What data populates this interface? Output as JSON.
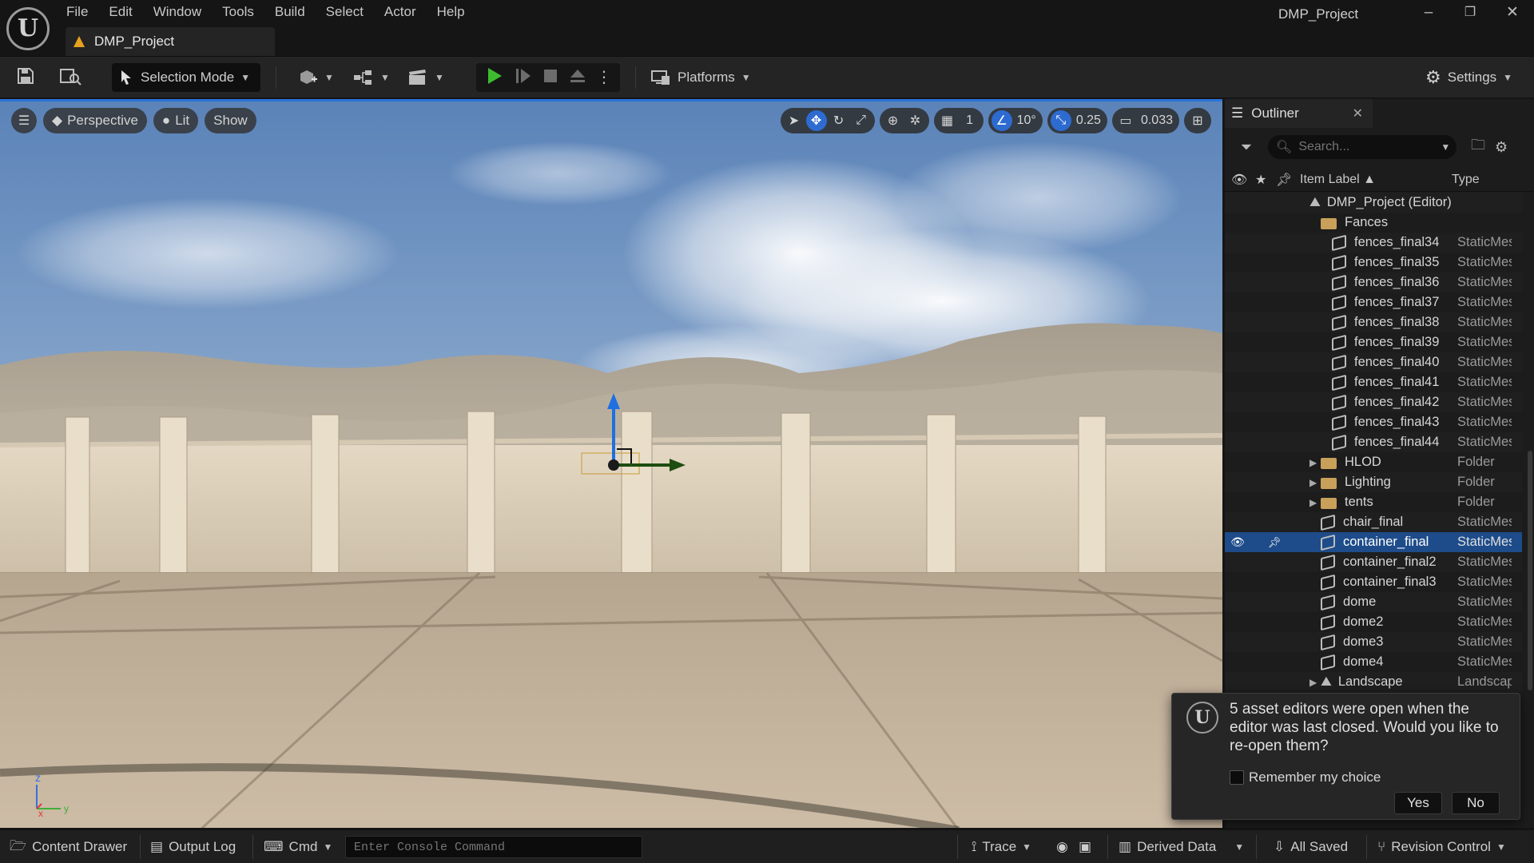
{
  "app": {
    "window_title": "DMP_Project",
    "project_tab": "DMP_Project",
    "menu": [
      "File",
      "Edit",
      "Window",
      "Tools",
      "Build",
      "Select",
      "Actor",
      "Help"
    ],
    "window_buttons": {
      "minimize": "–",
      "restore": "❐",
      "close": "✕"
    }
  },
  "toolbar": {
    "selection_mode": "Selection Mode",
    "platforms": "Platforms",
    "settings": "Settings"
  },
  "viewport": {
    "view_mode": "Perspective",
    "lighting": "Lit",
    "show": "Show",
    "grid_size": "1",
    "rotation_snap": "10°",
    "scale_snap": "0.25",
    "camera_speed": "0.033",
    "axis_labels": {
      "z": "z",
      "x": "x",
      "y": "y"
    }
  },
  "outliner": {
    "title": "Outliner",
    "search_placeholder": "Search...",
    "col_label": "Item Label ▲",
    "col_type": "Type",
    "rows": [
      {
        "indent": 1,
        "kind": "root",
        "label": "DMP_Project (Editor)",
        "type": ""
      },
      {
        "indent": 2,
        "kind": "folder-open",
        "label": "Fances",
        "type": ""
      },
      {
        "indent": 3,
        "kind": "mesh",
        "label": "fences_final34",
        "type": "StaticMesh"
      },
      {
        "indent": 3,
        "kind": "mesh",
        "label": "fences_final35",
        "type": "StaticMesh"
      },
      {
        "indent": 3,
        "kind": "mesh",
        "label": "fences_final36",
        "type": "StaticMesh"
      },
      {
        "indent": 3,
        "kind": "mesh",
        "label": "fences_final37",
        "type": "StaticMesh"
      },
      {
        "indent": 3,
        "kind": "mesh",
        "label": "fences_final38",
        "type": "StaticMesh"
      },
      {
        "indent": 3,
        "kind": "mesh",
        "label": "fences_final39",
        "type": "StaticMesh"
      },
      {
        "indent": 3,
        "kind": "mesh",
        "label": "fences_final40",
        "type": "StaticMesh"
      },
      {
        "indent": 3,
        "kind": "mesh",
        "label": "fences_final41",
        "type": "StaticMesh"
      },
      {
        "indent": 3,
        "kind": "mesh",
        "label": "fences_final42",
        "type": "StaticMesh"
      },
      {
        "indent": 3,
        "kind": "mesh",
        "label": "fences_final43",
        "type": "StaticMesh"
      },
      {
        "indent": 3,
        "kind": "mesh",
        "label": "fences_final44",
        "type": "StaticMesh"
      },
      {
        "indent": 2,
        "kind": "folder",
        "label": "HLOD",
        "type": "Folder"
      },
      {
        "indent": 2,
        "kind": "folder",
        "label": "Lighting",
        "type": "Folder"
      },
      {
        "indent": 2,
        "kind": "folder",
        "label": "tents",
        "type": "Folder"
      },
      {
        "indent": 2,
        "kind": "mesh",
        "label": "chair_final",
        "type": "StaticMesh"
      },
      {
        "indent": 2,
        "kind": "mesh",
        "label": "container_final",
        "type": "StaticMesh",
        "selected": true
      },
      {
        "indent": 2,
        "kind": "mesh",
        "label": "container_final2",
        "type": "StaticMesh"
      },
      {
        "indent": 2,
        "kind": "mesh",
        "label": "container_final3",
        "type": "StaticMesh"
      },
      {
        "indent": 2,
        "kind": "mesh",
        "label": "dome",
        "type": "StaticMesh"
      },
      {
        "indent": 2,
        "kind": "mesh",
        "label": "dome2",
        "type": "StaticMesh"
      },
      {
        "indent": 2,
        "kind": "mesh",
        "label": "dome3",
        "type": "StaticMesh"
      },
      {
        "indent": 2,
        "kind": "mesh",
        "label": "dome4",
        "type": "StaticMesh"
      },
      {
        "indent": 2,
        "kind": "landscape",
        "label": "Landscape",
        "type": "Landscape"
      }
    ]
  },
  "notification": {
    "message": "5 asset editors were open when the editor was last closed. Would you like to re-open them?",
    "checkbox_label": "Remember my choice",
    "yes": "Yes",
    "no": "No"
  },
  "statusbar": {
    "content_drawer": "Content Drawer",
    "output_log": "Output Log",
    "cmd": "Cmd",
    "console_placeholder": "Enter Console Command",
    "trace": "Trace",
    "derived_data": "Derived Data",
    "all_saved": "All Saved",
    "revision_control": "Revision Control"
  }
}
